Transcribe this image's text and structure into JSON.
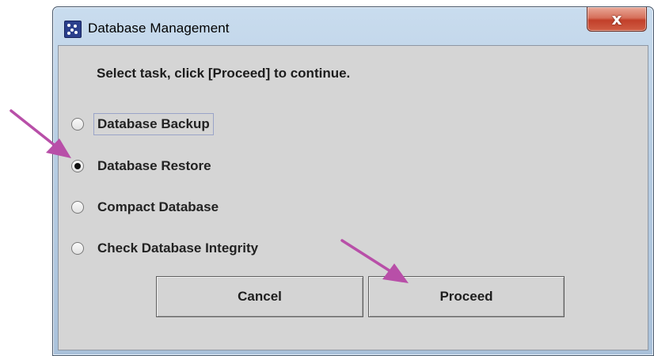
{
  "window": {
    "title": "Database Management",
    "close_label": "x",
    "icon": "java-app-icon"
  },
  "dialog": {
    "instruction": "Select task, click [Proceed] to continue.",
    "options": [
      {
        "label": "Database Backup",
        "selected": false,
        "focused": true
      },
      {
        "label": "Database Restore",
        "selected": true,
        "focused": false
      },
      {
        "label": "Compact Database",
        "selected": false,
        "focused": false
      },
      {
        "label": "Check Database Integrity",
        "selected": false,
        "focused": false
      }
    ],
    "cancel_label": "Cancel",
    "proceed_label": "Proceed"
  },
  "annotations": {
    "arrow_color": "#b84fa8"
  }
}
